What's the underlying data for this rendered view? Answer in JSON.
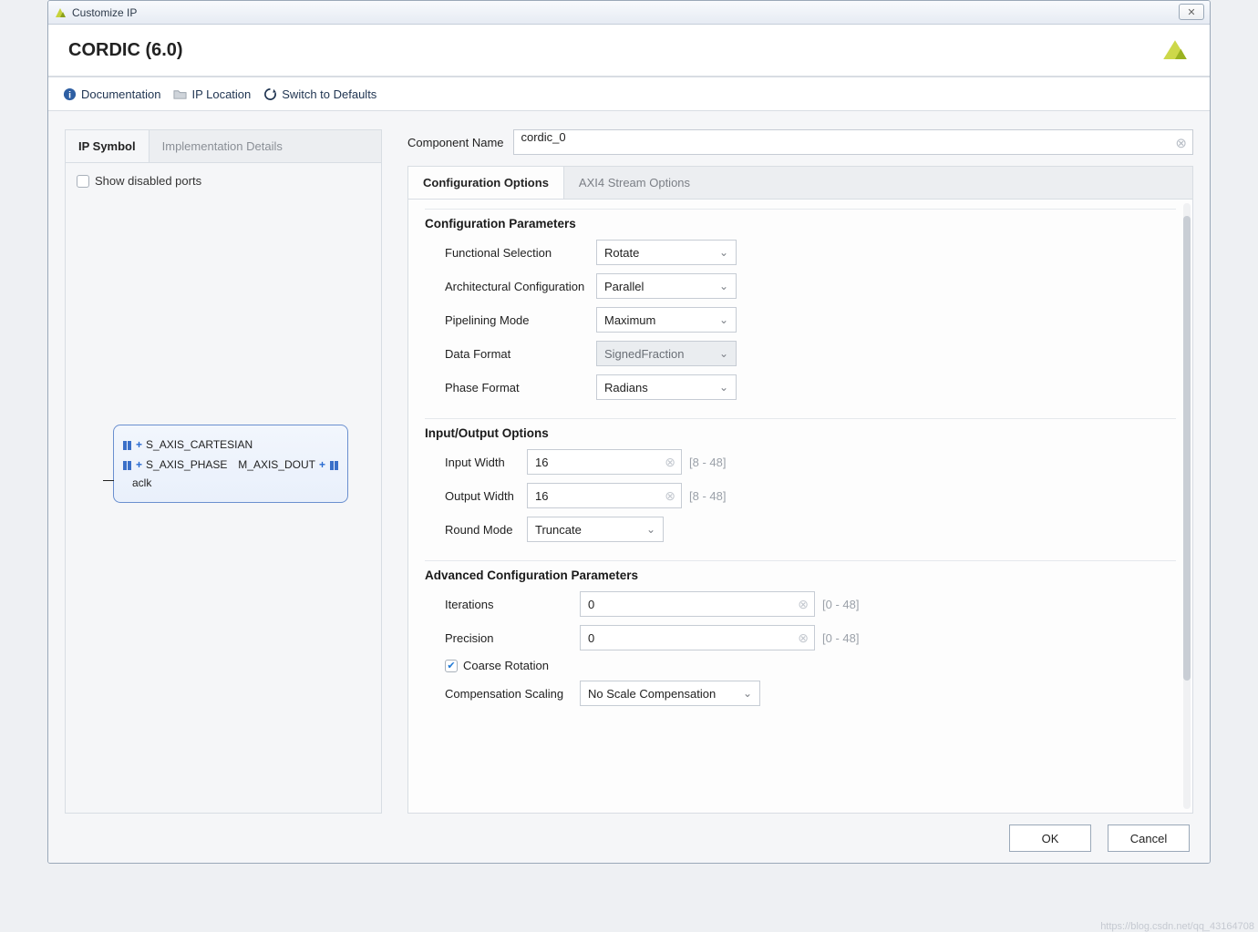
{
  "window": {
    "title": "Customize IP"
  },
  "header": {
    "title": "CORDIC (6.0)"
  },
  "toolbar": {
    "doc": "Documentation",
    "iploc": "IP Location",
    "defaults": "Switch to Defaults"
  },
  "left": {
    "tabs": {
      "symbol": "IP Symbol",
      "impl": "Implementation Details"
    },
    "show_disabled": "Show disabled ports",
    "ports": {
      "cartesian": "S_AXIS_CARTESIAN",
      "phase": "S_AXIS_PHASE",
      "dout": "M_AXIS_DOUT",
      "aclk": "aclk"
    }
  },
  "component": {
    "label": "Component Name",
    "value": "cordic_0"
  },
  "ctabs": {
    "config": "Configuration Options",
    "axi": "AXI4 Stream Options"
  },
  "sections": {
    "config_params": "Configuration Parameters",
    "io_options": "Input/Output Options",
    "adv_params": "Advanced Configuration Parameters"
  },
  "fields": {
    "func_sel": {
      "label": "Functional Selection",
      "value": "Rotate"
    },
    "arch_cfg": {
      "label": "Architectural Configuration",
      "value": "Parallel"
    },
    "pipe_mode": {
      "label": "Pipelining Mode",
      "value": "Maximum"
    },
    "data_fmt": {
      "label": "Data Format",
      "value": "SignedFraction"
    },
    "phase_fmt": {
      "label": "Phase Format",
      "value": "Radians"
    },
    "input_width": {
      "label": "Input Width",
      "value": "16",
      "hint": "[8 - 48]"
    },
    "output_width": {
      "label": "Output Width",
      "value": "16",
      "hint": "[8 - 48]"
    },
    "round_mode": {
      "label": "Round Mode",
      "value": "Truncate"
    },
    "iterations": {
      "label": "Iterations",
      "value": "0",
      "hint": "[0 - 48]"
    },
    "precision": {
      "label": "Precision",
      "value": "0",
      "hint": "[0 - 48]"
    },
    "coarse": {
      "label": "Coarse Rotation",
      "checked": true
    },
    "comp_scaling": {
      "label": "Compensation Scaling",
      "value": "No Scale Compensation"
    }
  },
  "footer": {
    "ok": "OK",
    "cancel": "Cancel"
  },
  "watermark": "https://blog.csdn.net/qq_43164708"
}
